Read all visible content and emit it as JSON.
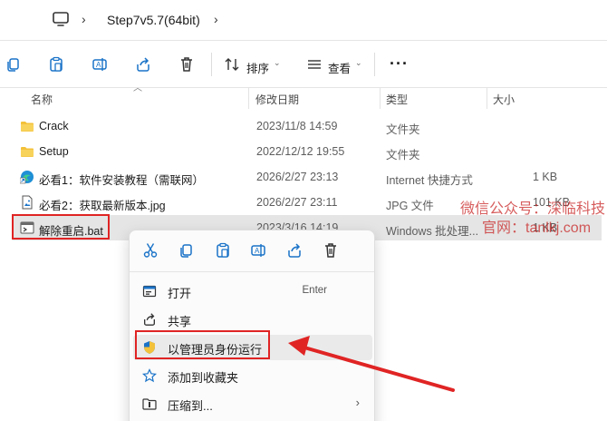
{
  "address": {
    "path": "Step7v5.7(64bit)"
  },
  "toolbar": {
    "sort_label": "排序",
    "view_label": "查看",
    "more_label": "···"
  },
  "columns": {
    "name": "名称",
    "modified": "修改日期",
    "type": "类型",
    "size": "大小"
  },
  "files": [
    {
      "name": "Crack",
      "modified": "2023/11/8 14:59",
      "type": "文件夹",
      "size": "",
      "icon": "folder-icon"
    },
    {
      "name": "Setup",
      "modified": "2022/12/12 19:55",
      "type": "文件夹",
      "size": "",
      "icon": "folder-icon"
    },
    {
      "name": "必看1：软件安装教程（需联网）",
      "modified": "2026/2/27 23:13",
      "type": "Internet 快捷方式",
      "size": "1 KB",
      "icon": "edge-shortcut-icon"
    },
    {
      "name": "必看2：获取最新版本.jpg",
      "modified": "2026/2/27 23:11",
      "type": "JPG 文件",
      "size": "101 KB",
      "icon": "image-file-icon"
    },
    {
      "name": "解除重启.bat",
      "modified": "2023/3/16 14:19",
      "type": "Windows 批处理...",
      "size": "1 KB",
      "icon": "batch-file-icon"
    }
  ],
  "watermark": {
    "line1": "微信公众号：深临科技",
    "line2": "官网：tanlkj.com"
  },
  "context_menu": {
    "items": [
      {
        "label": "打开",
        "shortcut": "Enter",
        "icon": "open-icon"
      },
      {
        "label": "共享",
        "shortcut": "",
        "icon": "share-icon"
      },
      {
        "label": "以管理员身份运行",
        "shortcut": "",
        "icon": "uac-shield-icon"
      },
      {
        "label": "添加到收藏夹",
        "shortcut": "",
        "icon": "star-icon"
      },
      {
        "label": "压缩到...",
        "shortcut": "",
        "icon": "zip-icon"
      }
    ],
    "submenu_arrow": "›"
  },
  "colors": {
    "highlight_red": "#e02424",
    "accent_blue": "#1a73c8",
    "folder_yellow": "#f3c13a"
  }
}
